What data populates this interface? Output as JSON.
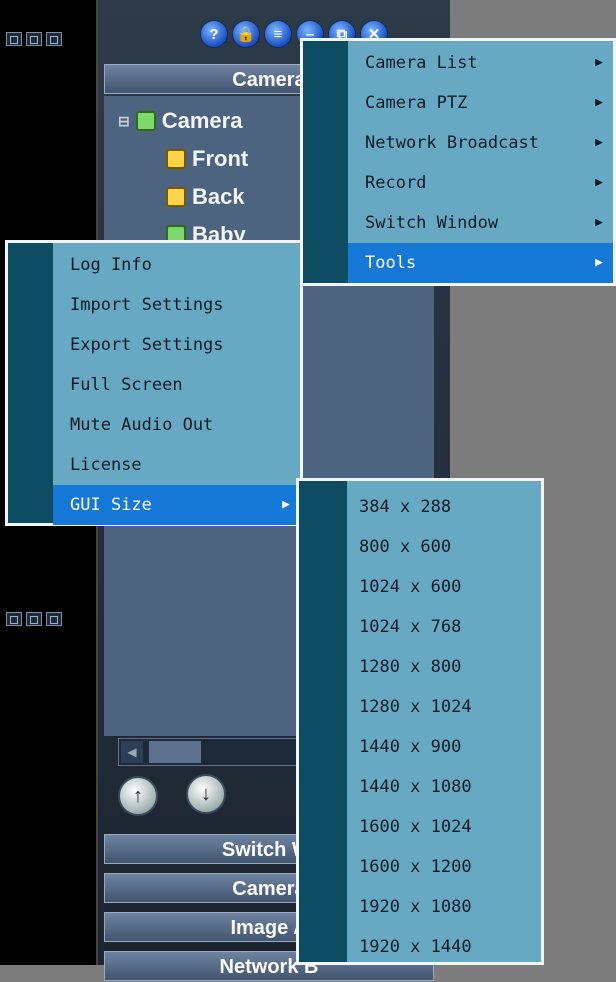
{
  "toolbar": {
    "buttons": [
      "?",
      "🔒",
      "≡",
      "–",
      "⧉",
      "✕"
    ],
    "icons": [
      "help-icon",
      "lock-icon",
      "list-icon",
      "minimize-icon",
      "restore-icon",
      "close-icon"
    ]
  },
  "panel": {
    "header_top": "Camera",
    "tree_root": "Camera",
    "tree_items": [
      "Front",
      "Back",
      "Baby"
    ],
    "headers_bottom": [
      "Switch Wi",
      "Camera",
      "Image A",
      "Network B"
    ]
  },
  "main_menu": {
    "items": [
      {
        "label": "Camera List",
        "submenu": true
      },
      {
        "label": "Camera PTZ",
        "submenu": true
      },
      {
        "label": "Network Broadcast",
        "submenu": true
      },
      {
        "label": "Record",
        "submenu": true
      },
      {
        "label": "Switch Window",
        "submenu": true
      },
      {
        "label": "Tools",
        "submenu": true,
        "active": true
      }
    ]
  },
  "tools_menu": {
    "items": [
      {
        "label": "Log Info"
      },
      {
        "label": "Import Settings"
      },
      {
        "label": "Export Settings"
      },
      {
        "label": "Full Screen"
      },
      {
        "label": "Mute Audio Out"
      },
      {
        "label": "License"
      },
      {
        "label": "GUI Size",
        "submenu": true,
        "active": true
      }
    ]
  },
  "gui_size_menu": {
    "items": [
      "384 x 288",
      "800 x 600",
      "1024 x 600",
      "1024 x 768",
      "1280 x 800",
      "1280 x 1024",
      "1440 x 900",
      "1440 x 1080",
      "1600 x 1024",
      "1600 x 1200",
      "1920 x 1080",
      "1920 x 1440"
    ]
  },
  "arrow_glyph": "▶",
  "colors": {
    "menu_bg": "#67a9c3",
    "menu_gutter": "#0e4c63",
    "highlight": "#1678d6"
  }
}
